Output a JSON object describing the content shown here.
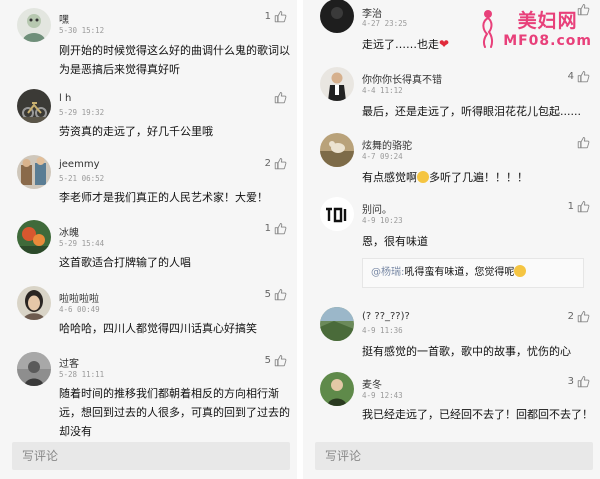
{
  "left": {
    "comments": [
      {
        "name": "嘿",
        "time": "5-30 15:12",
        "likes": "1",
        "text": "刚开始的时候觉得这么好的曲调什么鬼的歌词以为是恶搞后来觉得真好听"
      },
      {
        "name": "l h",
        "time": "5-29 19:32",
        "likes": "",
        "text": "劳资真的走远了，好几千公里哦"
      },
      {
        "name": "jeemmy",
        "time": "5-21 06:52",
        "likes": "2",
        "text": "李老师才是我们真正的人民艺术家！大爱！"
      },
      {
        "name": "冰魄",
        "time": "5-29 15:44",
        "likes": "1",
        "text": "这首歌适合打牌输了的人唱"
      },
      {
        "name": "啦啦啦啦",
        "time": "4-6 00:49",
        "likes": "5",
        "text": "哈哈哈，四川人都觉得四川话真心好搞笑"
      },
      {
        "name": "过客",
        "time": "5-28 11:11",
        "likes": "5",
        "text": "随着时间的推移我们都朝着相反的方向相行渐远，想回到过去的人很多，可真的回到了过去的却没有"
      }
    ],
    "input_placeholder": "写评论"
  },
  "right": {
    "comments": [
      {
        "name": "李治",
        "time": "4-27 23:25",
        "likes": "",
        "text": "走远了……也走"
      },
      {
        "name": "你你你长得真不错",
        "time": "4-4 11:12",
        "likes": "4",
        "text": "最后，还是走远了，听得眼泪花花儿包起......"
      },
      {
        "name": "炫舞的骆驼",
        "time": "4-7 09:24",
        "likes": "",
        "text_a": "有点感觉啊",
        "text_b": "多听了几遍！！！！"
      },
      {
        "name": "别问。",
        "time": "4-9 10:23",
        "likes": "1",
        "text": "恩，很有味道",
        "reply_at": "@杨瑞:",
        "reply_text": "吼得蛮有味道，您觉得呢"
      },
      {
        "name": "(? ??_??)?",
        "time": "4-9 11:36",
        "likes": "2",
        "text": "挺有感觉的一首歌，歌中的故事，忧伤的心"
      },
      {
        "name": "麦冬",
        "time": "4-9 12:43",
        "likes": "3",
        "text": "我已经走远了，已经回不去了！回都回不去了！"
      }
    ],
    "input_placeholder": "写评论",
    "watermark": {
      "line1": "美妇网",
      "line2": "MF08.com"
    }
  },
  "colors": {
    "bg": "#f6f6f6",
    "watermark": "#e8407a",
    "heart": "#e02a3a"
  }
}
